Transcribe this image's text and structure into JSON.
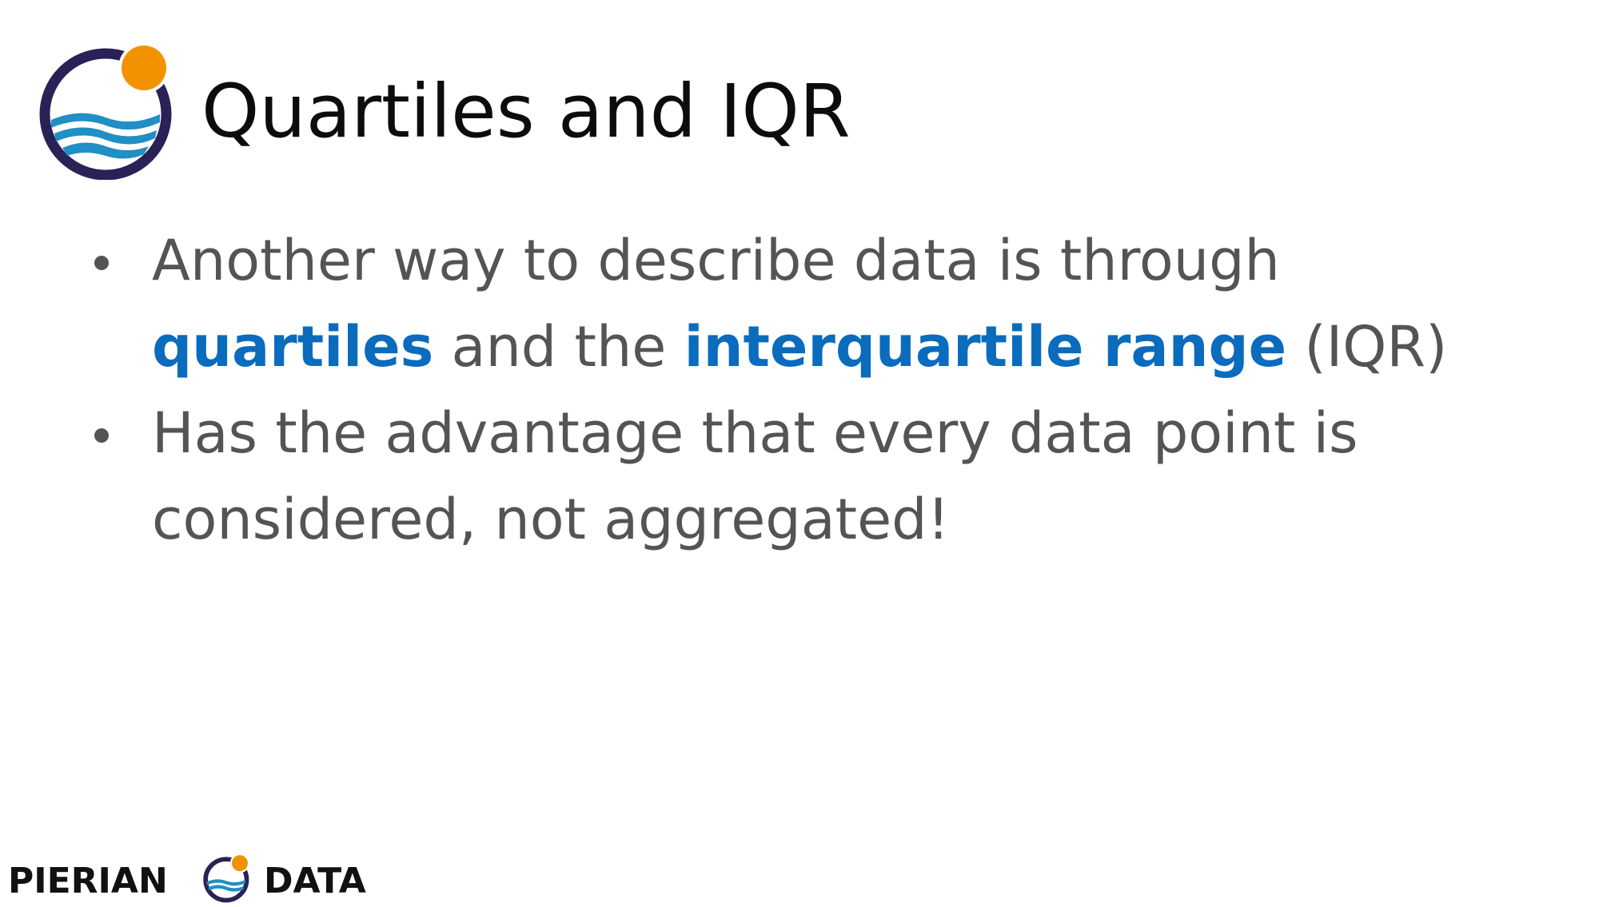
{
  "title": "Quartiles and IQR",
  "logo": {
    "icon": "pierian-data-logo-icon"
  },
  "bullets": [
    {
      "part1": "Another way to describe data is through ",
      "highlight1": "quartiles",
      "part2": " and the ",
      "highlight2": "interquartile range",
      "part3": " (IQR)"
    },
    {
      "text": "Has the advantage that every data point is considered, not aggregated!"
    }
  ],
  "footer": {
    "brand_left": "PIERIAN",
    "brand_right": "DATA"
  },
  "colors": {
    "text": "#545454",
    "title": "#0c0c0c",
    "highlight": "#0b6bbd",
    "logo_ring": "#2b2156",
    "logo_sun": "#f39200",
    "logo_wave": "#1f8fc4"
  }
}
